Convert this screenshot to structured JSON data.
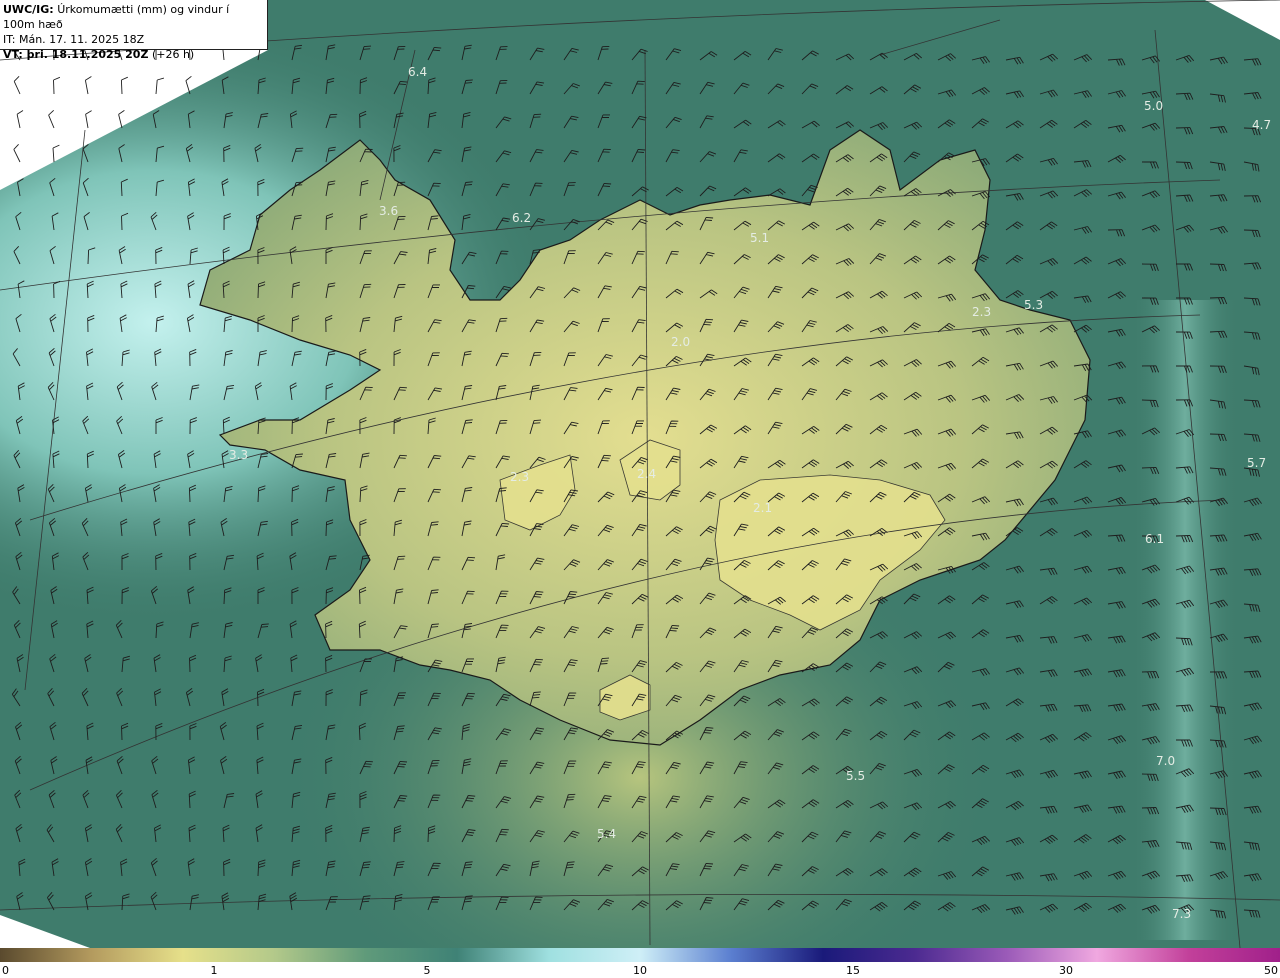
{
  "header": {
    "product": "UWC/IG:",
    "description": "Úrkomumætti (mm) og vindur í 100m hæð",
    "it": "IT: Mán. 17. 11. 2025 18Z",
    "vt_label": "VT: þri. 18.11.2025 20Z",
    "vt_suffix": "(+26 h)"
  },
  "values": [
    {
      "text": "6.4"
    },
    {
      "text": "5.0"
    },
    {
      "text": "4.7"
    },
    {
      "text": "3.6"
    },
    {
      "text": "6.2"
    },
    {
      "text": "5.1"
    },
    {
      "text": "5.3"
    },
    {
      "text": "2.3"
    },
    {
      "text": "2.0"
    },
    {
      "text": "3.3"
    },
    {
      "text": "2.3"
    },
    {
      "text": "2.4"
    },
    {
      "text": "2.1"
    },
    {
      "text": "5.7"
    },
    {
      "text": "6.1"
    },
    {
      "text": "7.0"
    },
    {
      "text": "5.5"
    },
    {
      "text": "5.4"
    },
    {
      "text": "7.3"
    }
  ],
  "colorbar": {
    "ticks": [
      "0",
      "1",
      "5",
      "10",
      "15",
      "30",
      "50"
    ],
    "colors": [
      "#5a4a2e",
      "#b39a5e",
      "#e6e08a",
      "#b3c98a",
      "#5f9a7a",
      "#3f8276",
      "#9fe0e0",
      "#cfeff7",
      "#5b7fd0",
      "#1a1a7a",
      "#4b2a90",
      "#9a5ab8",
      "#f0a8e0",
      "#c2409a",
      "#a0208a"
    ]
  },
  "colors": {
    "sea": "#3f7c6c",
    "sea_light": "#9ed8d2",
    "land": "#8fae78",
    "highland": "#d7d88e",
    "grid": "#333333",
    "coast": "#1a1a1a"
  }
}
